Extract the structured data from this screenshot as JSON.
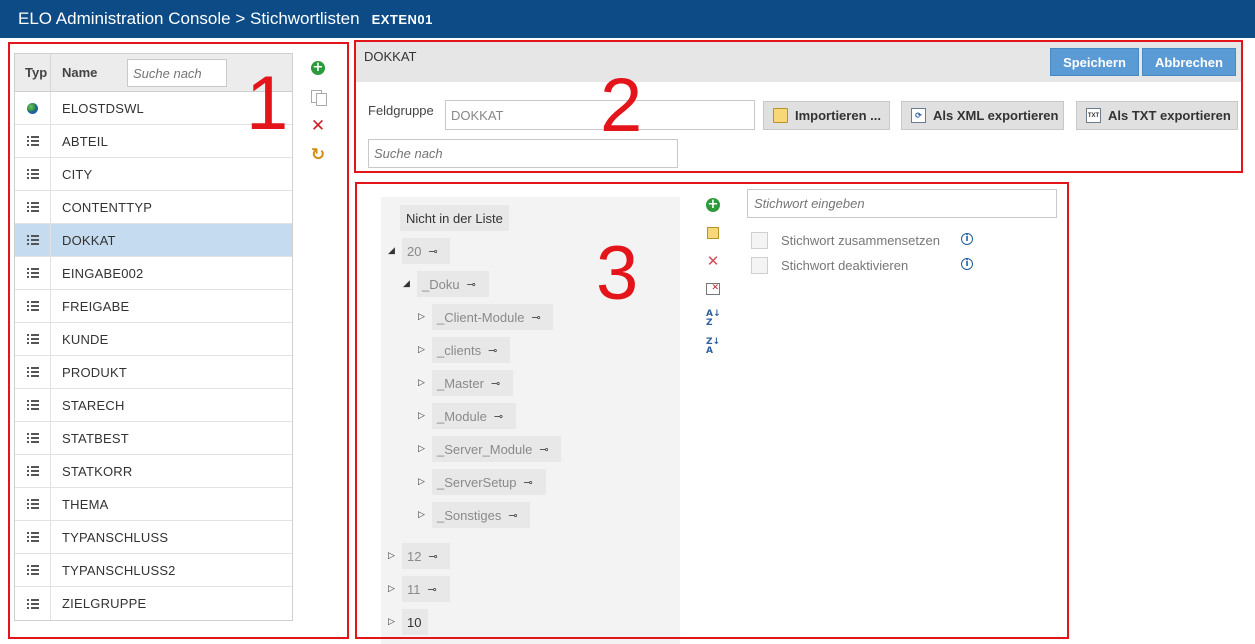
{
  "header": {
    "title": "ELO Administration Console > Stichwortlisten",
    "tenant": "EXTEN01"
  },
  "annotations": [
    "1",
    "2",
    "3"
  ],
  "list": {
    "col_typ": "Typ",
    "col_name": "Name",
    "search_placeholder": "Suche nach",
    "items": [
      {
        "name": "ELOSTDSWL",
        "icon": "globe-icon"
      },
      {
        "name": "ABTEIL",
        "icon": "list-icon"
      },
      {
        "name": "CITY",
        "icon": "list-icon"
      },
      {
        "name": "CONTENTTYP",
        "icon": "list-icon"
      },
      {
        "name": "DOKKAT",
        "icon": "list-icon",
        "selected": true
      },
      {
        "name": "EINGABE002",
        "icon": "list-icon"
      },
      {
        "name": "FREIGABE",
        "icon": "list-icon"
      },
      {
        "name": "KUNDE",
        "icon": "list-icon"
      },
      {
        "name": "PRODUKT",
        "icon": "list-icon"
      },
      {
        "name": "STARECH",
        "icon": "list-icon"
      },
      {
        "name": "STATBEST",
        "icon": "list-icon"
      },
      {
        "name": "STATKORR",
        "icon": "list-icon"
      },
      {
        "name": "THEMA",
        "icon": "list-icon"
      },
      {
        "name": "TYPANSCHLUSS",
        "icon": "list-icon"
      },
      {
        "name": "TYPANSCHLUSS2",
        "icon": "list-icon"
      },
      {
        "name": "ZIELGRUPPE",
        "icon": "list-icon"
      }
    ],
    "tools": [
      "add-icon",
      "copy-icon",
      "delete-icon",
      "refresh-icon"
    ]
  },
  "detail": {
    "title": "DOKKAT",
    "save_label": "Speichern",
    "cancel_label": "Abbrechen",
    "fieldgroup_label": "Feldgruppe",
    "fieldgroup_value": "DOKKAT",
    "import_label": "Importieren ...",
    "export_xml_label": "Als XML exportieren",
    "export_txt_label": "Als TXT exportieren",
    "search_placeholder": "Suche nach"
  },
  "tree": {
    "not_in_list": "Nicht in der Liste",
    "n20": "20",
    "n_doku": "_Doku",
    "children": [
      "_Client-Module",
      "_clients",
      "_Master",
      "_Module",
      "_Server_Module",
      "_ServerSetup",
      "_Sonstiges"
    ],
    "n12": "12",
    "n11": "11",
    "n10": "10"
  },
  "keyword": {
    "placeholder": "Stichwort eingeben",
    "combine_label": "Stichwort zusammensetzen",
    "deactivate_label": "Stichwort deaktivieren",
    "tools": [
      "add-icon",
      "add-sibling-icon",
      "delete-icon",
      "delete-all-icon",
      "sort-asc-icon",
      "sort-desc-icon"
    ]
  },
  "colors": {
    "header_bg": "#0c4b86",
    "annotation_red": "#e4141b",
    "selected_row": "#c5dbef",
    "primary_button": "#5b9bd5"
  }
}
